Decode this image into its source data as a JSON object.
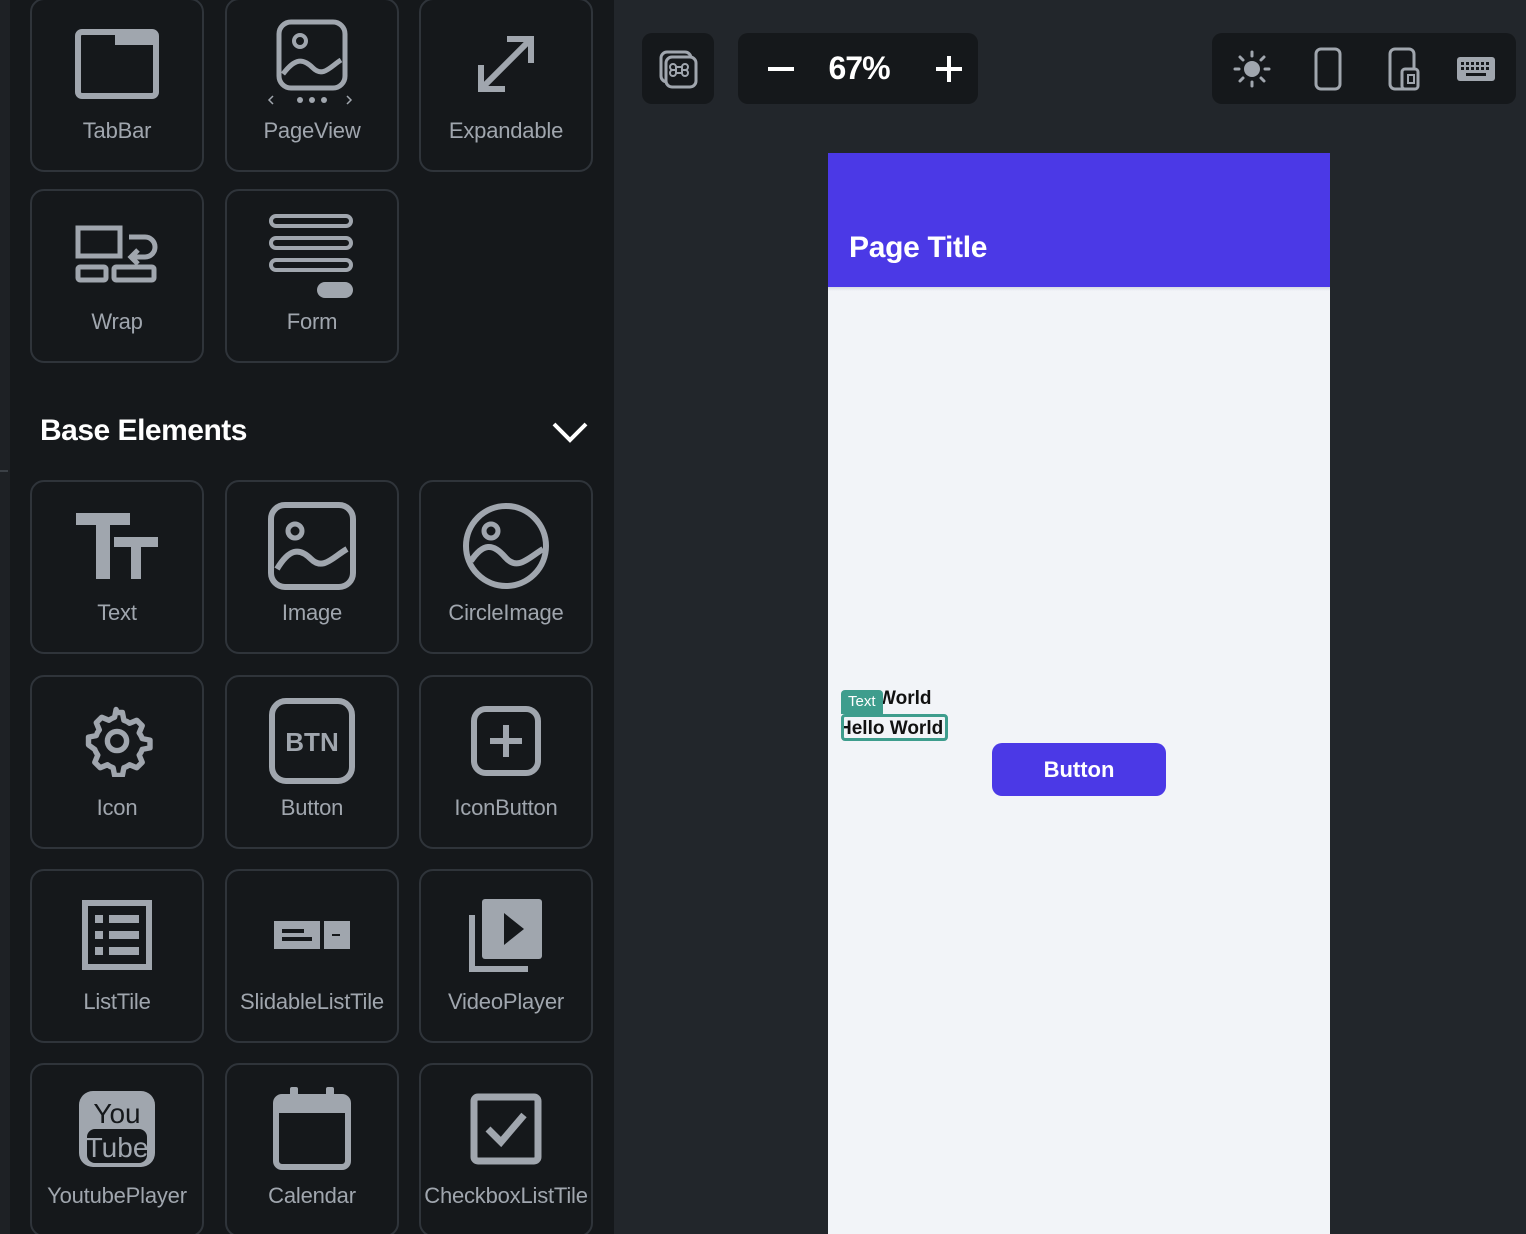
{
  "palette": {
    "accent": "#4b39e6",
    "selection": "#3e9d8d",
    "panel": "#15181b",
    "canvas": "#22262b",
    "tile_border": "#2f343a",
    "icon_gray": "#a0a6ae"
  },
  "widgets_top": [
    {
      "label": "TabBar",
      "icon": "tabbar-icon"
    },
    {
      "label": "PageView",
      "icon": "pageview-icon"
    },
    {
      "label": "Expandable",
      "icon": "expand-icon"
    },
    {
      "label": "Wrap",
      "icon": "wrap-icon"
    },
    {
      "label": "Form",
      "icon": "form-icon"
    }
  ],
  "base_section": {
    "title": "Base Elements",
    "toggle_icon": "chevron-down-icon"
  },
  "base_elements": [
    {
      "label": "Text",
      "icon": "text-icon"
    },
    {
      "label": "Image",
      "icon": "image-icon"
    },
    {
      "label": "CircleImage",
      "icon": "circle-image-icon"
    },
    {
      "label": "Icon",
      "icon": "gear-icon"
    },
    {
      "label": "Button",
      "icon": "btn-icon",
      "icon_text": "BTN"
    },
    {
      "label": "IconButton",
      "icon": "plus-square-icon"
    },
    {
      "label": "ListTile",
      "icon": "list-icon"
    },
    {
      "label": "SlidableListTile",
      "icon": "slidable-icon"
    },
    {
      "label": "VideoPlayer",
      "icon": "video-icon"
    },
    {
      "label": "YoutubePlayer",
      "icon": "youtube-icon",
      "icon_text_top": "You",
      "icon_text_bottom": "Tube"
    },
    {
      "label": "Calendar",
      "icon": "calendar-icon"
    },
    {
      "label": "CheckboxListTile",
      "icon": "checkbox-icon"
    }
  ],
  "toolbar": {
    "command_icon": "command-icon",
    "zoom": {
      "minus_icon": "minus-icon",
      "value": "67%",
      "plus_icon": "plus-icon"
    },
    "right_icons": [
      "sun-icon",
      "phone-icon",
      "tablet-icon",
      "keyboard-icon"
    ]
  },
  "canvas": {
    "appbar_title": "Page Title",
    "text_partial": "World",
    "selected_text": "Hello World",
    "selection_tag": "Text",
    "button_label": "Button"
  }
}
